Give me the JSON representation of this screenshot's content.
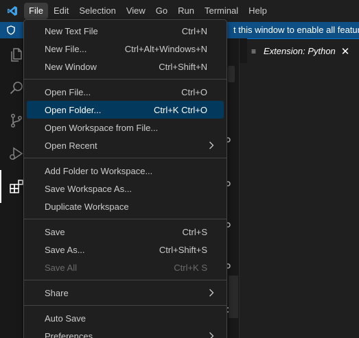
{
  "menubar": {
    "items": [
      {
        "label": "File"
      },
      {
        "label": "Edit"
      },
      {
        "label": "Selection"
      },
      {
        "label": "View"
      },
      {
        "label": "Go"
      },
      {
        "label": "Run"
      },
      {
        "label": "Terminal"
      },
      {
        "label": "Help"
      }
    ]
  },
  "banner": {
    "text": "t this window to enable all features."
  },
  "activitybar": {
    "icons": [
      "explorer-icon",
      "search-icon",
      "source-control-icon",
      "run-debug-icon",
      "extensions-icon"
    ]
  },
  "editor": {
    "tab_label": "Extension: Python",
    "tab_close": "✕"
  },
  "file_menu": {
    "items": [
      {
        "label": "New Text File",
        "key": "Ctrl+N"
      },
      {
        "label": "New File...",
        "key": "Ctrl+Alt+Windows+N"
      },
      {
        "label": "New Window",
        "key": "Ctrl+Shift+N"
      },
      {
        "label": "Open File...",
        "key": "Ctrl+O"
      },
      {
        "label": "Open Folder...",
        "key": "Ctrl+K Ctrl+O"
      },
      {
        "label": "Open Workspace from File...",
        "key": ""
      },
      {
        "label": "Open Recent",
        "key": ""
      },
      {
        "label": "Add Folder to Workspace...",
        "key": ""
      },
      {
        "label": "Save Workspace As...",
        "key": ""
      },
      {
        "label": "Duplicate Workspace",
        "key": ""
      },
      {
        "label": "Save",
        "key": "Ctrl+S"
      },
      {
        "label": "Save As...",
        "key": "Ctrl+Shift+S"
      },
      {
        "label": "Save All",
        "key": "Ctrl+K S"
      },
      {
        "label": "Share",
        "key": ""
      },
      {
        "label": "Auto Save",
        "key": ""
      },
      {
        "label": "Preferences",
        "key": ""
      }
    ]
  },
  "colors": {
    "accent": "#0078d4",
    "banner": "#0e4f86",
    "menu_highlight": "#04395e",
    "background": "#1f1f1f"
  }
}
